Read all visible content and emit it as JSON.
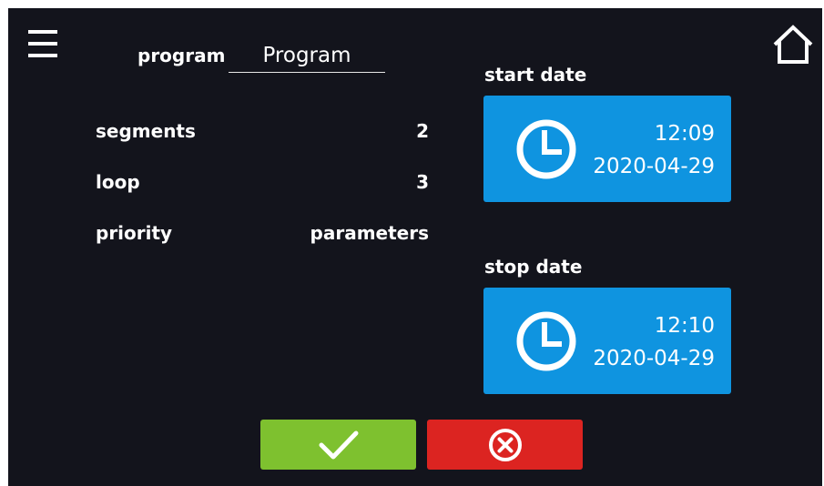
{
  "header": {
    "menu_icon": "hamburger-menu-icon",
    "home_icon": "home-icon"
  },
  "program": {
    "label": "program",
    "value": "Program"
  },
  "fields": {
    "segments_label": "segments",
    "segments_value": "2",
    "loop_label": "loop",
    "loop_value": "3",
    "priority_label": "priority",
    "priority_value": "parameters"
  },
  "start": {
    "label": "start date",
    "time": "12:09",
    "date": "2020-04-29",
    "icon": "clock-icon"
  },
  "stop": {
    "label": "stop date",
    "time": "12:10",
    "date": "2020-04-29",
    "icon": "clock-icon"
  },
  "actions": {
    "confirm_icon": "checkmark-icon",
    "cancel_icon": "cancel-circle-x-icon"
  },
  "colors": {
    "background": "#13141c",
    "date_button": "#0f94e0",
    "confirm": "#7ec12f",
    "cancel": "#dc2421"
  }
}
